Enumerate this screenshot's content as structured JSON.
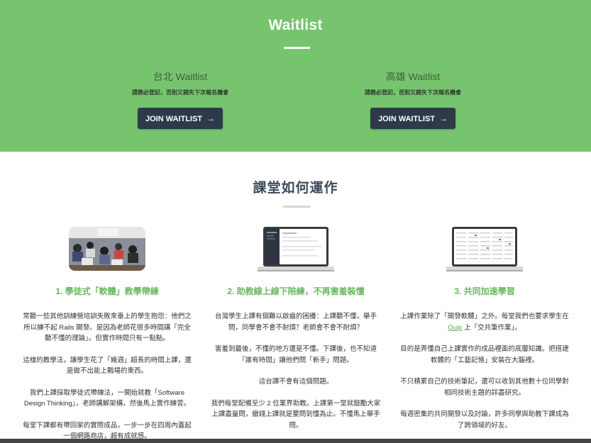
{
  "hero": {
    "title": "Waitlist",
    "background": "#77c46f",
    "taipei": {
      "title": "台北 Waitlist",
      "note": "請務必登記，否則又錯失下次報名機會",
      "button_label": "JOIN WAITLIST",
      "button_icon": "arrow-right-icon"
    },
    "kaohsiung": {
      "title": "高雄 Waitlist",
      "note": "請務必登記，否則又錯失下次報名機會",
      "button_label": "JOIN WAITLIST",
      "button_icon": "arrow-right-icon"
    }
  },
  "section": {
    "title": "課堂如何運作",
    "columns": [
      {
        "illustration": "classroom-photo",
        "title": "1. 學徒式「軟體」教學帶練",
        "paragraphs": [
          "常聽一些其他訓練營培訓失敗來垂上的學生抱怨：他們之所以練不起 Rails 開發。是因為老師花很多時間講「完全聽不懂的理論」。但實作時間只有一點點。",
          "這樣的教學法，讓學生花了「幾週」超長的時間上課，還是做不出能上戰場的東西。",
          "我們上課採取學徒式帶練法，一開始就教「Software Design Thinking」，老師講解架構，然後馬上實作練習。",
          "每堂下課都有帶回家的實際成品，一步一步在四周內蓋起一個網路商店，超有成就感。"
        ]
      },
      {
        "illustration": "laptop-chat-screen",
        "title": "2. 助教線上線下陪練，不再害羞裝懂",
        "paragraphs": [
          "台灣學生上課有個難以啟齒的困擾：上課聽不懂，舉手問，同學會不會不耐煩？老師會不會不耐煩？",
          "害羞到最後，不懂的地方還是不懂。下課後，也不知道「誰有時間」讓他們問「新手」問題。",
          "這台課不會有這個問題。",
          "我們每堂配備至少 2 位業界助教。上課第一堂就鼓勵大家上課盡量問，繳錢上課就是要問到懂為止。不懂馬上舉手問。"
        ]
      },
      {
        "illustration": "laptop-notes-screen",
        "title": "3. 共同加速學習",
        "p1_prefix": "上課作業除了「開發軟體」之外。每堂我們也要求學生在",
        "p1_link": "Quip",
        "p1_suffix": "上「交共筆作業」。",
        "paragraphs": [
          "目的是弄懂自己上課實作的成品裡面的底層知識。把搭建軟體的「工藝記憶」安裝在大腦裡。",
          "不只積累自己的技術筆記，還可以收到其他數十位同學對相同技術主題的詳盡研究。",
          "每週密集的共同開發以及討論，許多同學與助教下課成為了跨領域的好友。"
        ]
      }
    ]
  },
  "colors": {
    "hero_green": "#77c46f",
    "button_dark": "#2e3a4a",
    "accent_green": "#68b85f",
    "heading_dark": "#3b4a5a"
  }
}
